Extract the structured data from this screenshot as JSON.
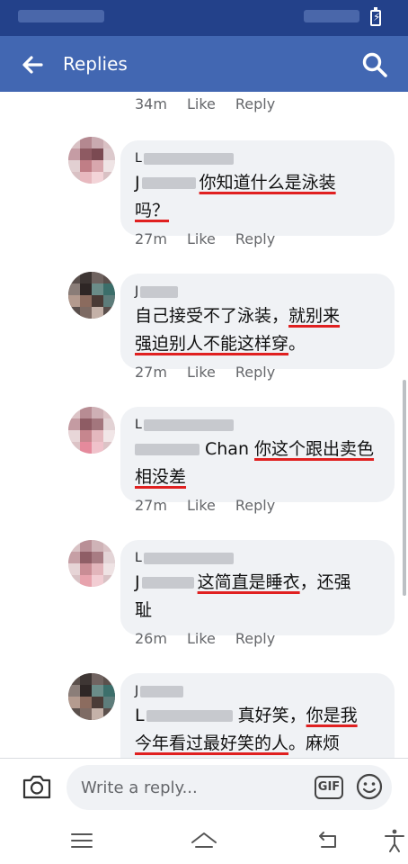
{
  "colors": {
    "header": "#4267b2",
    "status_bar": "#23418a",
    "bubble": "#f0f2f5",
    "underline": "#e02020"
  },
  "header": {
    "title": "Replies",
    "back_icon": "arrow-left-icon",
    "search_icon": "search-icon"
  },
  "first_meta": {
    "time": "34m",
    "like": "Like",
    "reply": "Reply"
  },
  "comments": [
    {
      "name": "L",
      "text_parts": [
        "J",
        "你知道什么是泳装",
        "吗？"
      ],
      "time": "27m",
      "like": "Like",
      "reply": "Reply"
    },
    {
      "name": "J",
      "text_parts": [
        "自己接受不了泳装，",
        "就别来",
        "强迫别人不能这样穿",
        "。"
      ],
      "time": "27m",
      "like": "Like",
      "reply": "Reply"
    },
    {
      "name": "L",
      "text_parts": [
        "Chan ",
        "你这个跟出卖色",
        "相没差"
      ],
      "time": "27m",
      "like": "Like",
      "reply": "Reply"
    },
    {
      "name": "L",
      "text_parts": [
        "J",
        "这简直是睡衣",
        "，还强",
        "耻"
      ],
      "time": "26m",
      "like": "Like",
      "reply": "Reply"
    },
    {
      "name": "J",
      "text_parts": [
        "L",
        "真好笑，",
        "你是我",
        "今年看过最好笑的人",
        "。麻烦"
      ]
    }
  ],
  "composer": {
    "placeholder": "Write a reply...",
    "gif_label": "GIF",
    "camera_icon": "camera-icon",
    "emoji_icon": "emoji-icon"
  },
  "nav": {
    "menu_icon": "menu-icon",
    "home_icon": "home-icon",
    "back_icon": "back-icon",
    "accessibility_icon": "accessibility-icon"
  }
}
